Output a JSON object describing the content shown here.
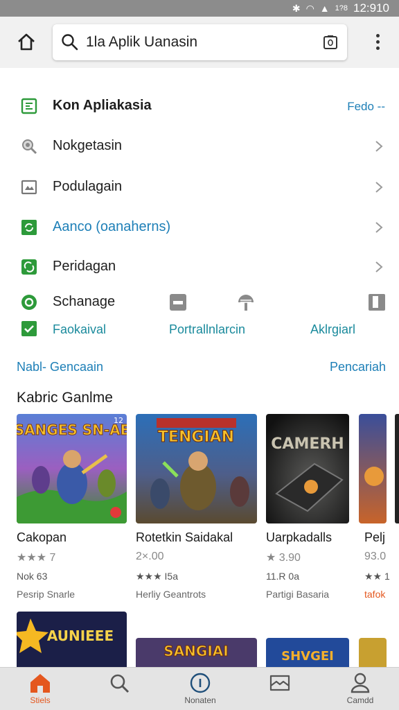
{
  "status_bar": {
    "time": "12:910",
    "signal_text": "1?8"
  },
  "search": {
    "query": "1la Aplik Uanasin"
  },
  "menu": [
    {
      "label": "Kon Apliakasia",
      "right": "Fedo --"
    },
    {
      "label": "Nokgetasin"
    },
    {
      "label": "Podulagain"
    },
    {
      "label": "Aanco (oanaherns)"
    },
    {
      "label": "Peridagan"
    }
  ],
  "options_row1": {
    "label": "Schanage"
  },
  "options_row2": [
    "Faokaival",
    "Portrallnlarcin",
    "Aklrgiarl"
  ],
  "links": {
    "left": "Nabl- Gencaain",
    "right": "Pencariah"
  },
  "section_title": "Kabric Ganlme",
  "cards": [
    {
      "title": "Cakopan",
      "price": "★★★ 7",
      "rating": "Nok 63",
      "dev": "Pesrip Snarle",
      "badge": "12"
    },
    {
      "title": "Rotetkin Saidakal",
      "price": "2×.00",
      "rating": "★★★ I5a",
      "dev": "Herliy Geantrots"
    },
    {
      "title": "Uarpkadalls",
      "price": "★ 3.90",
      "rating": "11.R 0a",
      "dev": "Partigi Basaria"
    },
    {
      "title": "Pelj",
      "price": "93.0",
      "rating": "★★ 1",
      "dev": "tafok"
    }
  ],
  "cover_text": [
    "SANGES SN-AE",
    "TENGIAN",
    "CAMERH",
    "AUNIEEE",
    "SANGIAI",
    "SHVGEI"
  ],
  "bottom_nav": [
    {
      "label": "Stiels",
      "icon": "home-icon"
    },
    {
      "label": "",
      "icon": "search-icon"
    },
    {
      "label": "Nonaten",
      "icon": "info-icon"
    },
    {
      "label": "",
      "icon": "inbox-icon"
    },
    {
      "label": "Camdd",
      "icon": "profile-icon"
    }
  ],
  "colors": {
    "accent_blue": "#1d7fb7",
    "accent_green": "#2d9a3a",
    "accent_orange": "#e4571e"
  }
}
